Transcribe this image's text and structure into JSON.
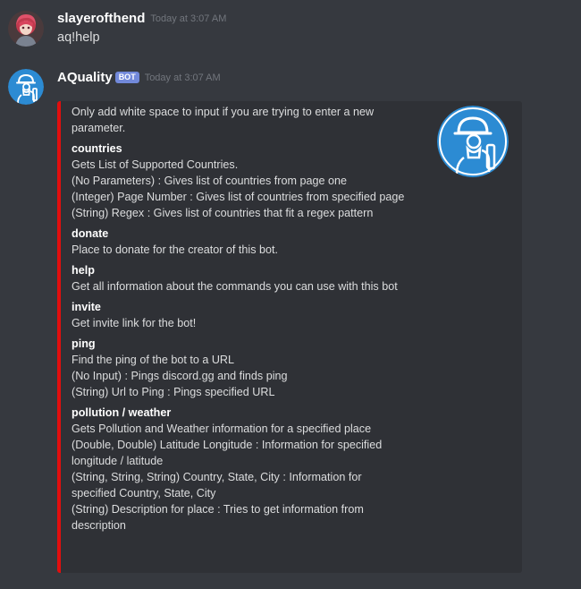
{
  "messages": [
    {
      "username": "slayerofthend",
      "timestamp": "Today at 3:07 AM",
      "content": "aq!help"
    },
    {
      "username": "AQuality",
      "bot_tag": "BOT",
      "timestamp": "Today at 3:07 AM"
    }
  ],
  "embed": {
    "color": "#e20e0e",
    "description": "Only add white space to input if you are trying to enter a new\nparameter.",
    "fields": [
      {
        "name": "countries",
        "value": "Gets List of Supported Countries.\n(No Parameters) : Gives list of countries from page one\n(Integer) Page Number : Gives list of countries from specified page\n(String) Regex : Gives list of countries that fit a regex pattern"
      },
      {
        "name": "donate",
        "value": "Place to donate for the creator of this bot."
      },
      {
        "name": "help",
        "value": "Get all information about the commands you can use with this bot"
      },
      {
        "name": "invite",
        "value": "Get invite link for the bot!"
      },
      {
        "name": "ping",
        "value": "Find the ping of the bot to a URL\n(No Input) : Pings discord.gg and finds ping\n(String) Url to Ping : Pings specified URL"
      },
      {
        "name": "pollution / weather",
        "value": "Gets Pollution and Weather information for a specified place\n(Double, Double) Latitude Longitude : Information for specified\nlongitude / latitude\n(String, String, String) Country, State, City : Information for\nspecified Country, State, City\n(String) Description for place : Tries to get information from\ndescription"
      }
    ]
  },
  "icons": {
    "user_avatar": "anime-character-avatar-icon",
    "bot_avatar": "gas-mask-worker-icon",
    "embed_thumbnail": "gas-mask-worker-icon"
  },
  "colors": {
    "background": "#36393f",
    "embed_background": "#2f3136",
    "bot_tag": "#7289da",
    "bot_avatar": "#2c8bd3"
  }
}
